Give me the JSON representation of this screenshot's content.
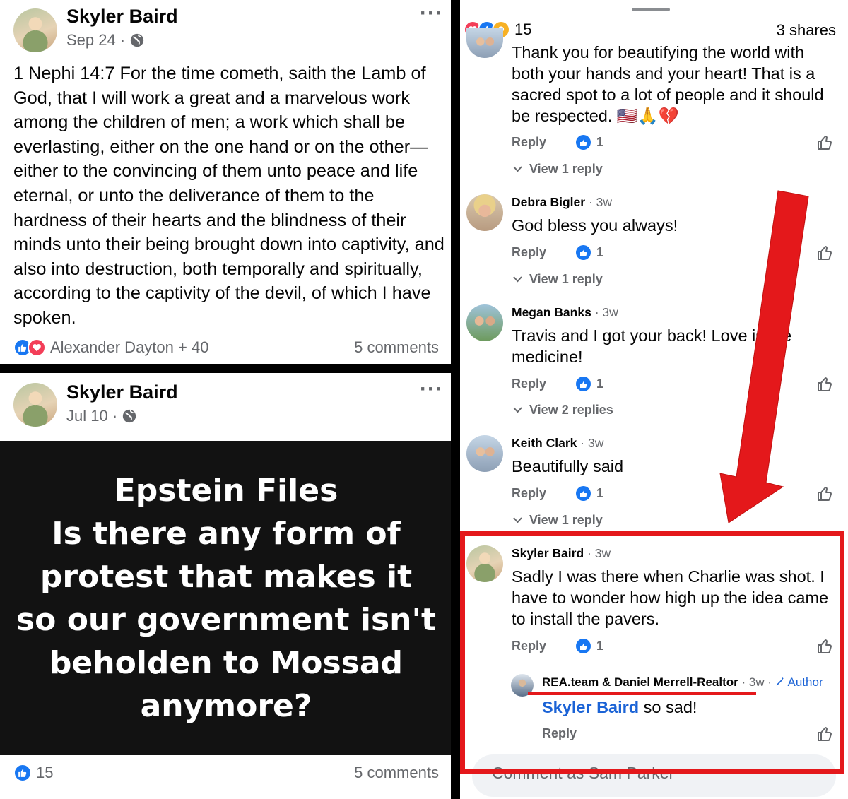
{
  "post1": {
    "author": "Skyler Baird",
    "date": "Sep 24 ·",
    "more_icon": "ellipsis-icon",
    "body": "1 Nephi 14:7 For the time cometh, saith the Lamb of God, that I will work a great and a marvelous work among the children of men; a work which shall be everlasting, either on the one hand or on the other—either to the convincing of them unto peace and life eternal, or unto the deliverance of them to the hardness of their hearts and the blindness of their minds unto their being brought down into captivity, and also into destruction, both temporally and spiritually, according to the captivity of the devil, of which I have spoken.",
    "reactions_text": "Alexander Dayton + 40",
    "comments": "5 comments"
  },
  "post2": {
    "author": "Skyler Baird",
    "date": "Jul 10 ·",
    "poster_text": "Epstein Files\nIs there any form of\nprotest that makes it\nso our government isn't\nbeholden to Mossad\nanymore?",
    "reaction_count": "15",
    "comments": "5 comments"
  },
  "thread": {
    "reaction_count": "15",
    "shares": "3 shares",
    "first_comment": {
      "text": "Thank you for beautifying the world with both your hands and your heart! That is a sacred spot to a lot of people and it should be respected. 🇺🇸🙏💔",
      "reply": "Reply",
      "likes": "1",
      "view": "View 1 reply"
    },
    "comments": [
      {
        "name": "Debra Bigler",
        "time": "· 3w",
        "text": "God bless you always!",
        "reply": "Reply",
        "likes": "1",
        "view": "View 1 reply"
      },
      {
        "name": "Megan Banks",
        "time": "· 3w",
        "text": "Travis and I got your back! Love is the medicine!",
        "reply": "Reply",
        "likes": "1",
        "view": "View 2 replies"
      },
      {
        "name": "Keith Clark",
        "time": "· 3w",
        "text": "Beautifully said",
        "reply": "Reply",
        "likes": "1",
        "view": "View 1 reply"
      },
      {
        "name": "Skyler Baird",
        "time": "· 3w",
        "text": "Sadly I was there when Charlie was shot. I have to wonder how high up the idea came to install the pavers.",
        "reply": "Reply",
        "likes": "1"
      }
    ],
    "nested_reply": {
      "name": "REA.team & Daniel Merrell-Realtor",
      "time": "· 3w ·",
      "author_badge": "Author",
      "mention": "Skyler Baird",
      "text": " so sad!",
      "reply": "Reply"
    },
    "input_placeholder": "Comment as Sam Parker"
  },
  "colors": {
    "annotation_red": "#e4181b",
    "like_blue": "#1877f2",
    "mention_blue": "#1b63d6"
  }
}
